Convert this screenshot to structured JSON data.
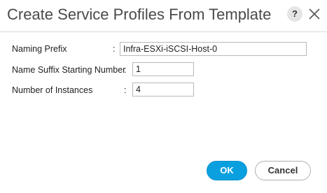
{
  "dialog": {
    "title": "Create Service Profiles From Template",
    "help_label": "?",
    "close_icon": "close-x-icon"
  },
  "form": {
    "naming_prefix": {
      "label": "Naming Prefix",
      "separator": ":",
      "value": "Infra-ESXi-iSCSI-Host-0"
    },
    "name_suffix": {
      "label": "Name Suffix Starting Number",
      "separator": ":",
      "value": "1"
    },
    "instances": {
      "label": "Number of Instances",
      "separator": ":",
      "value": "4"
    }
  },
  "buttons": {
    "ok_label": "OK",
    "cancel_label": "Cancel",
    "ok_color": "#0aa0e0"
  }
}
